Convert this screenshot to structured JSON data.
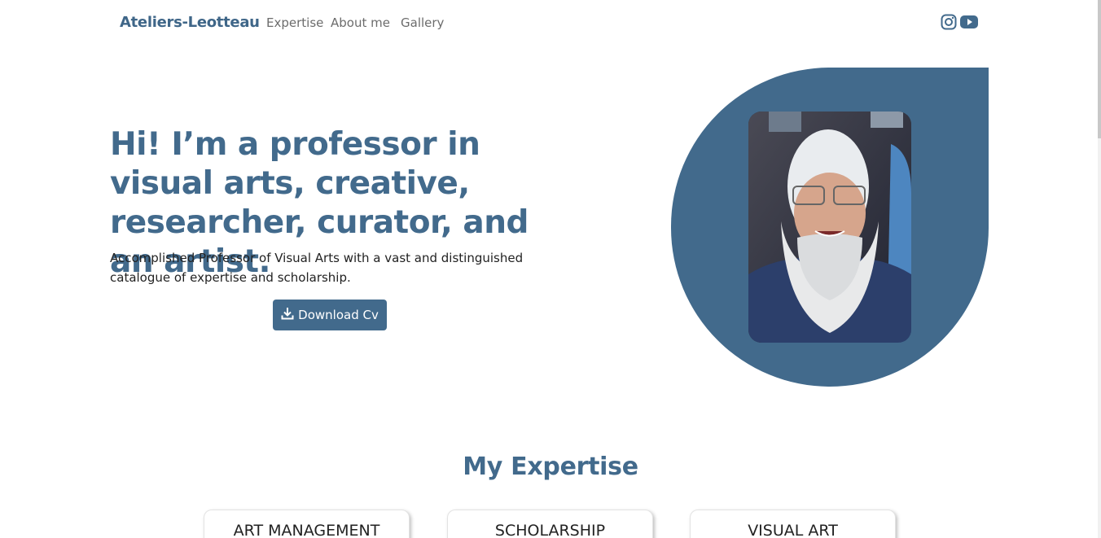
{
  "nav": {
    "brand": "Ateliers-Leotteau",
    "links": [
      "Expertise",
      "About me",
      "Gallery"
    ],
    "social_icons": [
      "instagram-icon",
      "youtube-icon"
    ]
  },
  "hero": {
    "title": "Hi! I’m a professor in visual arts, creative, researcher, curator, and an artist.",
    "subtitle": "Accomplished Professor of Visual Arts with a vast and distinguished catalogue of expertise and scholarship.",
    "button_label": "Download Cv",
    "button_icon": "download-icon"
  },
  "expertise": {
    "title": "My Expertise",
    "cards": [
      "ART MANAGEMENT",
      "SCHOLARSHIP",
      "VISUAL ART"
    ]
  },
  "colors": {
    "accent": "#426a8c",
    "brand": "#3f6688",
    "nav_text": "#6c6c6c",
    "background": "#ffffff"
  }
}
